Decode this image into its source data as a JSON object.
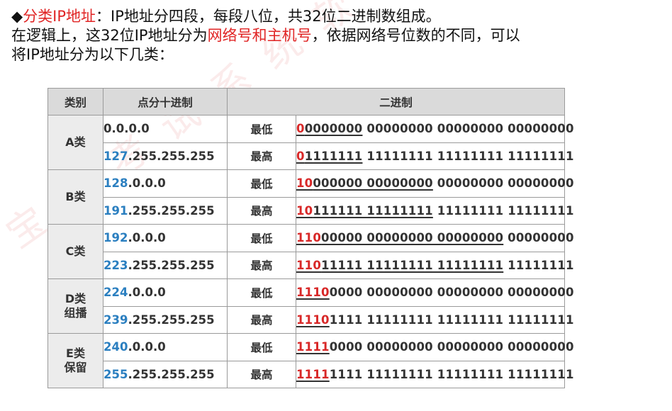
{
  "intro": {
    "line1_bullet": "◆",
    "line1_term": "分类IP地址",
    "line1_rest": "：IP地址分四段，每段八位，共32位二进制数组成。",
    "line2_a": "在逻辑上，这32位IP地址分为",
    "line2_term": "网络号和主机号",
    "line2_b": "，依据网络号位数的不同，可以",
    "line3": "将IP地址分为以下几类："
  },
  "watermark": "宝拟考试系统软件",
  "table": {
    "headers": [
      "类别",
      "点分十进制",
      "二进制"
    ],
    "rows": [
      {
        "class_line1": "A类",
        "class_line2": "",
        "low": {
          "dotted_hi": "",
          "dotted_rest": "0.0.0.0",
          "level": "最低",
          "bin_prefix": "0",
          "bin_ul_rest": "0000000",
          "bin_rest": " 00000000 00000000 00000000"
        },
        "high": {
          "dotted_hi": "127",
          "dotted_rest": ".255.255.255",
          "level": "最高",
          "bin_prefix": "0",
          "bin_ul_rest": "1111111",
          "bin_rest": " 11111111 11111111 11111111"
        }
      },
      {
        "class_line1": "B类",
        "class_line2": "",
        "low": {
          "dotted_hi": "128",
          "dotted_rest": ".0.0.0",
          "level": "最低",
          "bin_prefix": "10",
          "bin_ul_rest": "000000 00000000",
          "bin_rest": " 00000000 00000000"
        },
        "high": {
          "dotted_hi": "191",
          "dotted_rest": ".255.255.255",
          "level": "最高",
          "bin_prefix": "10",
          "bin_ul_rest": "111111 11111111",
          "bin_rest": " 11111111 11111111"
        }
      },
      {
        "class_line1": "C类",
        "class_line2": "",
        "low": {
          "dotted_hi": "192",
          "dotted_rest": ".0.0.0",
          "level": "最低",
          "bin_prefix": "110",
          "bin_ul_rest": "00000 00000000 00000000",
          "bin_rest": " 00000000"
        },
        "high": {
          "dotted_hi": "223",
          "dotted_rest": ".255.255.255",
          "level": "最高",
          "bin_prefix": "110",
          "bin_ul_rest": "11111 11111111 11111111",
          "bin_rest": " 11111111"
        }
      },
      {
        "class_line1": "D类",
        "class_line2": "组播",
        "low": {
          "dotted_hi": "224",
          "dotted_rest": ".0.0.0",
          "level": "最低",
          "bin_prefix": "1110",
          "bin_ul_rest": "",
          "bin_rest": "0000 00000000 00000000 00000000"
        },
        "high": {
          "dotted_hi": "239",
          "dotted_rest": ".255.255.255",
          "level": "最高",
          "bin_prefix": "1110",
          "bin_ul_rest": "",
          "bin_rest": "1111 11111111 11111111 11111111"
        }
      },
      {
        "class_line1": "E类",
        "class_line2": "保留",
        "low": {
          "dotted_hi": "240",
          "dotted_rest": ".0.0.0",
          "level": "最低",
          "bin_prefix": "1111",
          "bin_ul_rest": "",
          "bin_rest": "0000 00000000 00000000 00000000"
        },
        "high": {
          "dotted_hi": "255",
          "dotted_rest": ".255.255.255",
          "level": "最高",
          "bin_prefix": "1111",
          "bin_ul_rest": "",
          "bin_rest": "1111 11111111 11111111 11111111"
        }
      }
    ]
  },
  "colors": {
    "highlight_red": "#e02424",
    "octet_blue": "#2b7fc0",
    "header_bg": "#dadada"
  }
}
